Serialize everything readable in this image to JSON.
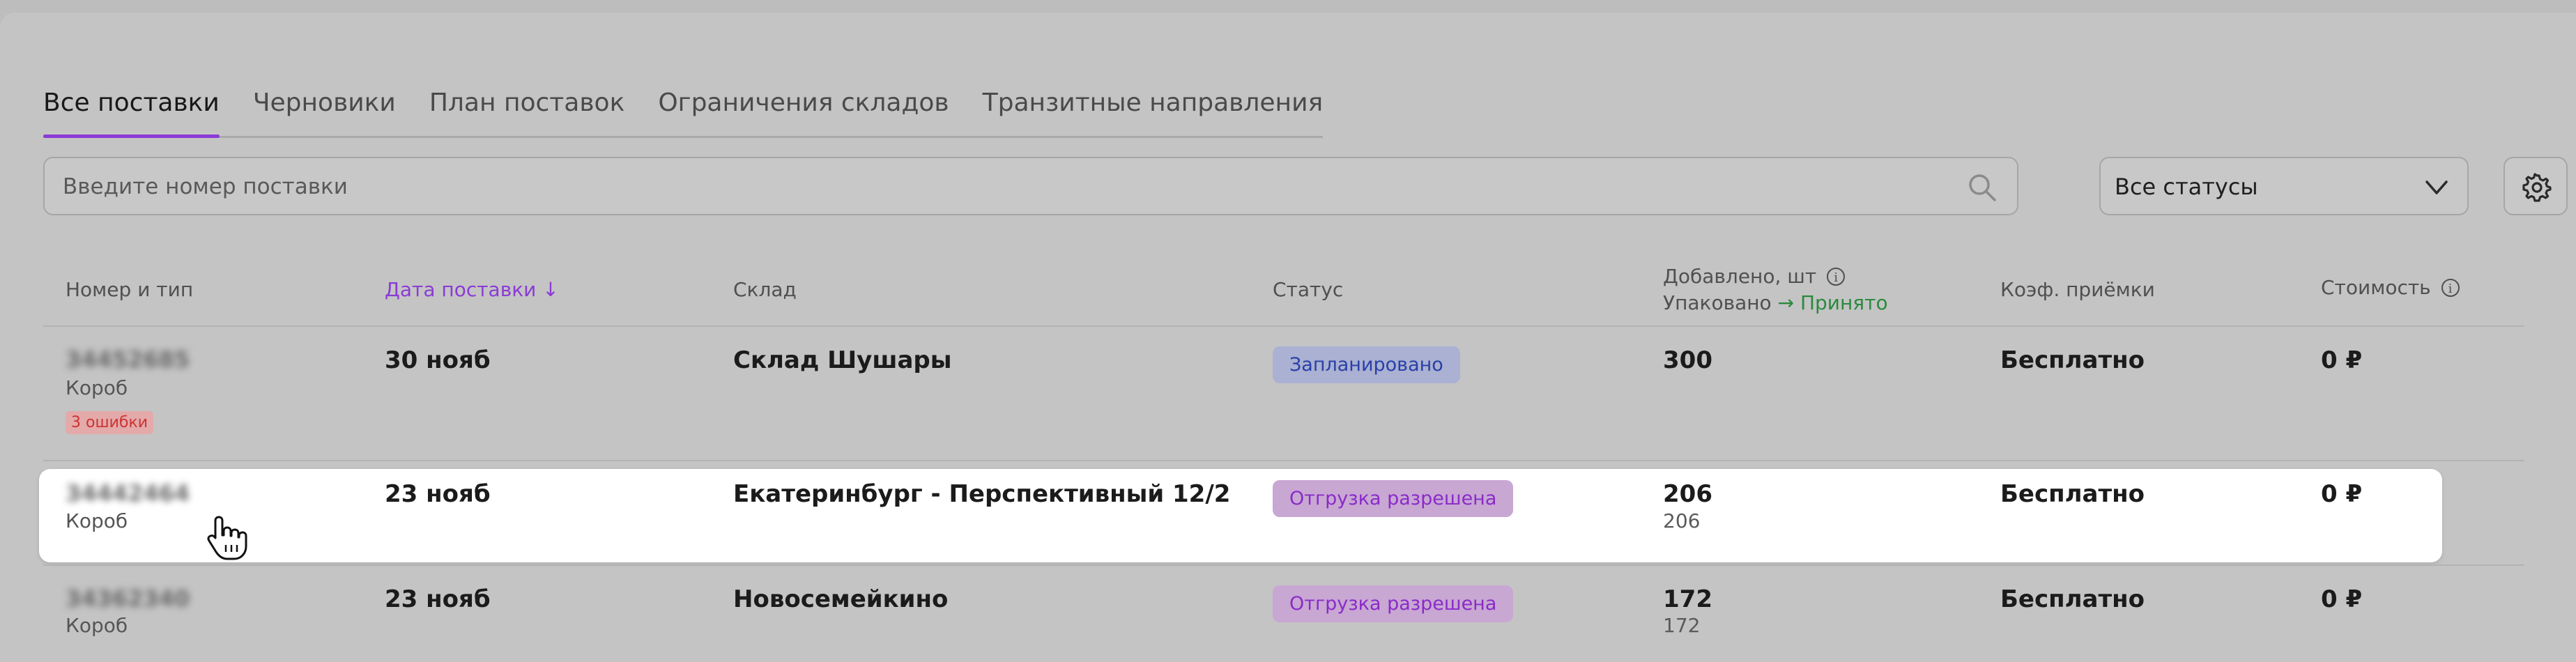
{
  "tabs": [
    {
      "label": "Все поставки",
      "active": true
    },
    {
      "label": "Черновики",
      "active": false
    },
    {
      "label": "План поставок",
      "active": false
    },
    {
      "label": "Ограничения складов",
      "active": false
    },
    {
      "label": "Транзитные направления",
      "active": false
    }
  ],
  "search": {
    "placeholder": "Введите номер поставки",
    "value": ""
  },
  "status_filter": {
    "value": "Все статусы"
  },
  "table": {
    "headers": {
      "number": "Номер и тип",
      "date": "Дата поставки",
      "warehouse": "Склад",
      "status": "Статус",
      "added": "Добавлено, шт",
      "packed": "Упаковано",
      "accepted": "Принято",
      "coef": "Коэф. приёмки",
      "cost": "Стоимость"
    },
    "rows": [
      {
        "number": "34452685",
        "type": "Короб",
        "errors": "3 ошибки",
        "date": "30 нояб",
        "warehouse": "Склад Шушары",
        "status": "Запланировано",
        "added": "300",
        "packed": "",
        "coef": "Бесплатно",
        "cost": "0 ₽"
      },
      {
        "number": "34442464",
        "type": "Короб",
        "errors": "",
        "date": "23 нояб",
        "warehouse": "Екатеринбург - Перспективный 12/2",
        "status": "Отгрузка разрешена",
        "added": "206",
        "packed": "206",
        "coef": "Бесплатно",
        "cost": "0 ₽"
      },
      {
        "number": "34362340",
        "type": "Короб",
        "errors": "",
        "date": "23 нояб",
        "warehouse": "Новосемейкино",
        "status": "Отгрузка разрешена",
        "added": "172",
        "packed": "172",
        "coef": "Бесплатно",
        "cost": "0 ₽"
      }
    ]
  },
  "colors": {
    "accent": "#8b3bd6",
    "accepted": "#2b8a3e",
    "planned_badge": "#2a40a8"
  }
}
